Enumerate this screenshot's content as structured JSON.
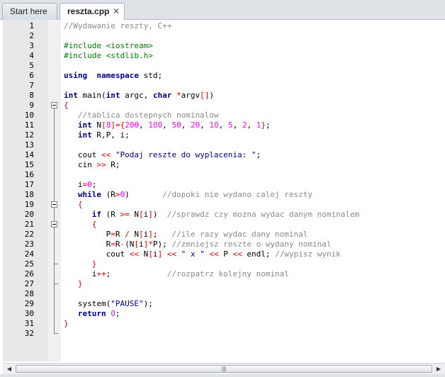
{
  "tabs": [
    {
      "label": "Start here"
    },
    {
      "label": "reszta.cpp",
      "close": "✕"
    }
  ],
  "editor": {
    "line_numbers": [
      "1",
      "2",
      "3",
      "4",
      "5",
      "6",
      "7",
      "8",
      "9",
      "10",
      "11",
      "12",
      "13",
      "14",
      "15",
      "16",
      "17",
      "18",
      "19",
      "20",
      "21",
      "22",
      "23",
      "24",
      "25",
      "26",
      "27",
      "28",
      "29",
      "30",
      "31",
      "32"
    ]
  },
  "scrollbar": {
    "left": "◀",
    "right": "▶",
    "grip": "|||"
  }
}
